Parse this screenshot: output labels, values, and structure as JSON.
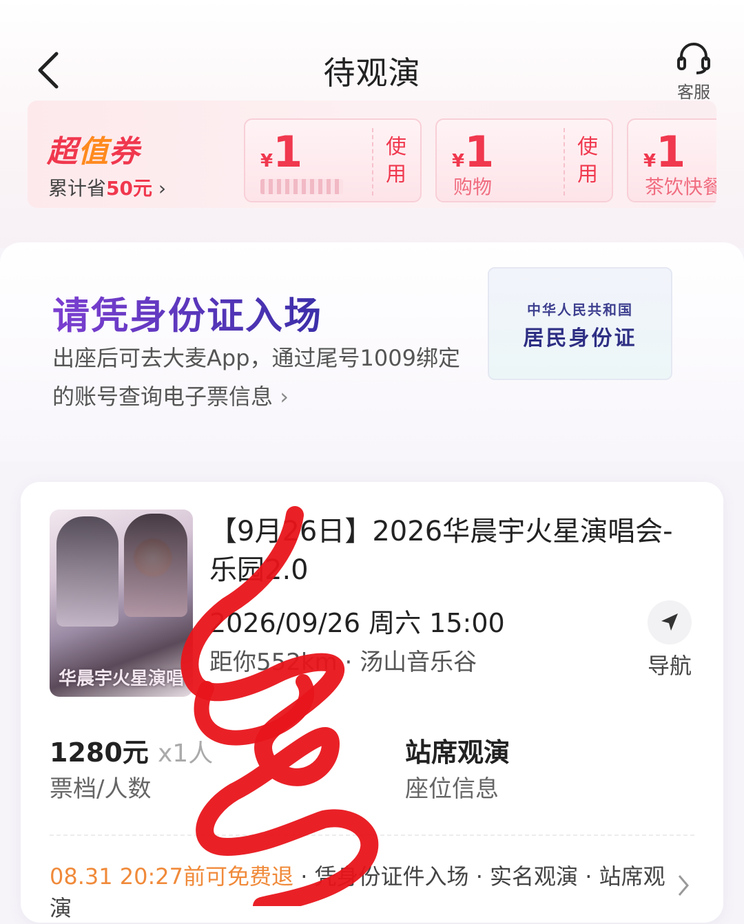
{
  "header": {
    "title": "待观演",
    "service_label": "客服"
  },
  "coupons": {
    "brand": "超值券",
    "brand_prefix": "超",
    "brand_bolt": "值",
    "brand_suffix": "券",
    "saved_prefix": "累计省",
    "saved_amount": "50元",
    "saved_chevron": "›",
    "items": [
      {
        "currency": "¥",
        "amount": "1",
        "desc": "",
        "use_label_1": "使",
        "use_label_2": "用"
      },
      {
        "currency": "¥",
        "amount": "1",
        "desc": "购物",
        "use_label_1": "使",
        "use_label_2": "用"
      },
      {
        "currency": "¥",
        "amount": "1",
        "desc": "茶饮快餐"
      }
    ]
  },
  "id_entry": {
    "title": "请凭身份证入场",
    "desc": "出座后可去大麦App，通过尾号1009绑定的账号查询电子票信息",
    "chevron": "›",
    "card_line1": "中华人民共和国",
    "card_line2": "居民身份证"
  },
  "ticket": {
    "title": "【9月26日】2026华晨宇火星演唱会-乐园2.0",
    "datetime": "2026/09/26 周六 15:00",
    "place": "距你552km · 汤山音乐谷",
    "nav_label": "导航",
    "poster_text": "华晨宇火星演唱",
    "price": "1280元",
    "quantity": "x1人",
    "price_label": "票档/人数",
    "seat": "站席观演",
    "seat_label": "座位信息",
    "notice_highlight": "08.31 20:27前可免费退",
    "notice_rest": " · 凭身份证件入场 · 实名观演 · 站席观演"
  },
  "colors": {
    "accent_red": "#f0384e",
    "accent_orange": "#f08a3a",
    "title_purple": "#6a3acb",
    "scribble_red": "#e8151b"
  }
}
